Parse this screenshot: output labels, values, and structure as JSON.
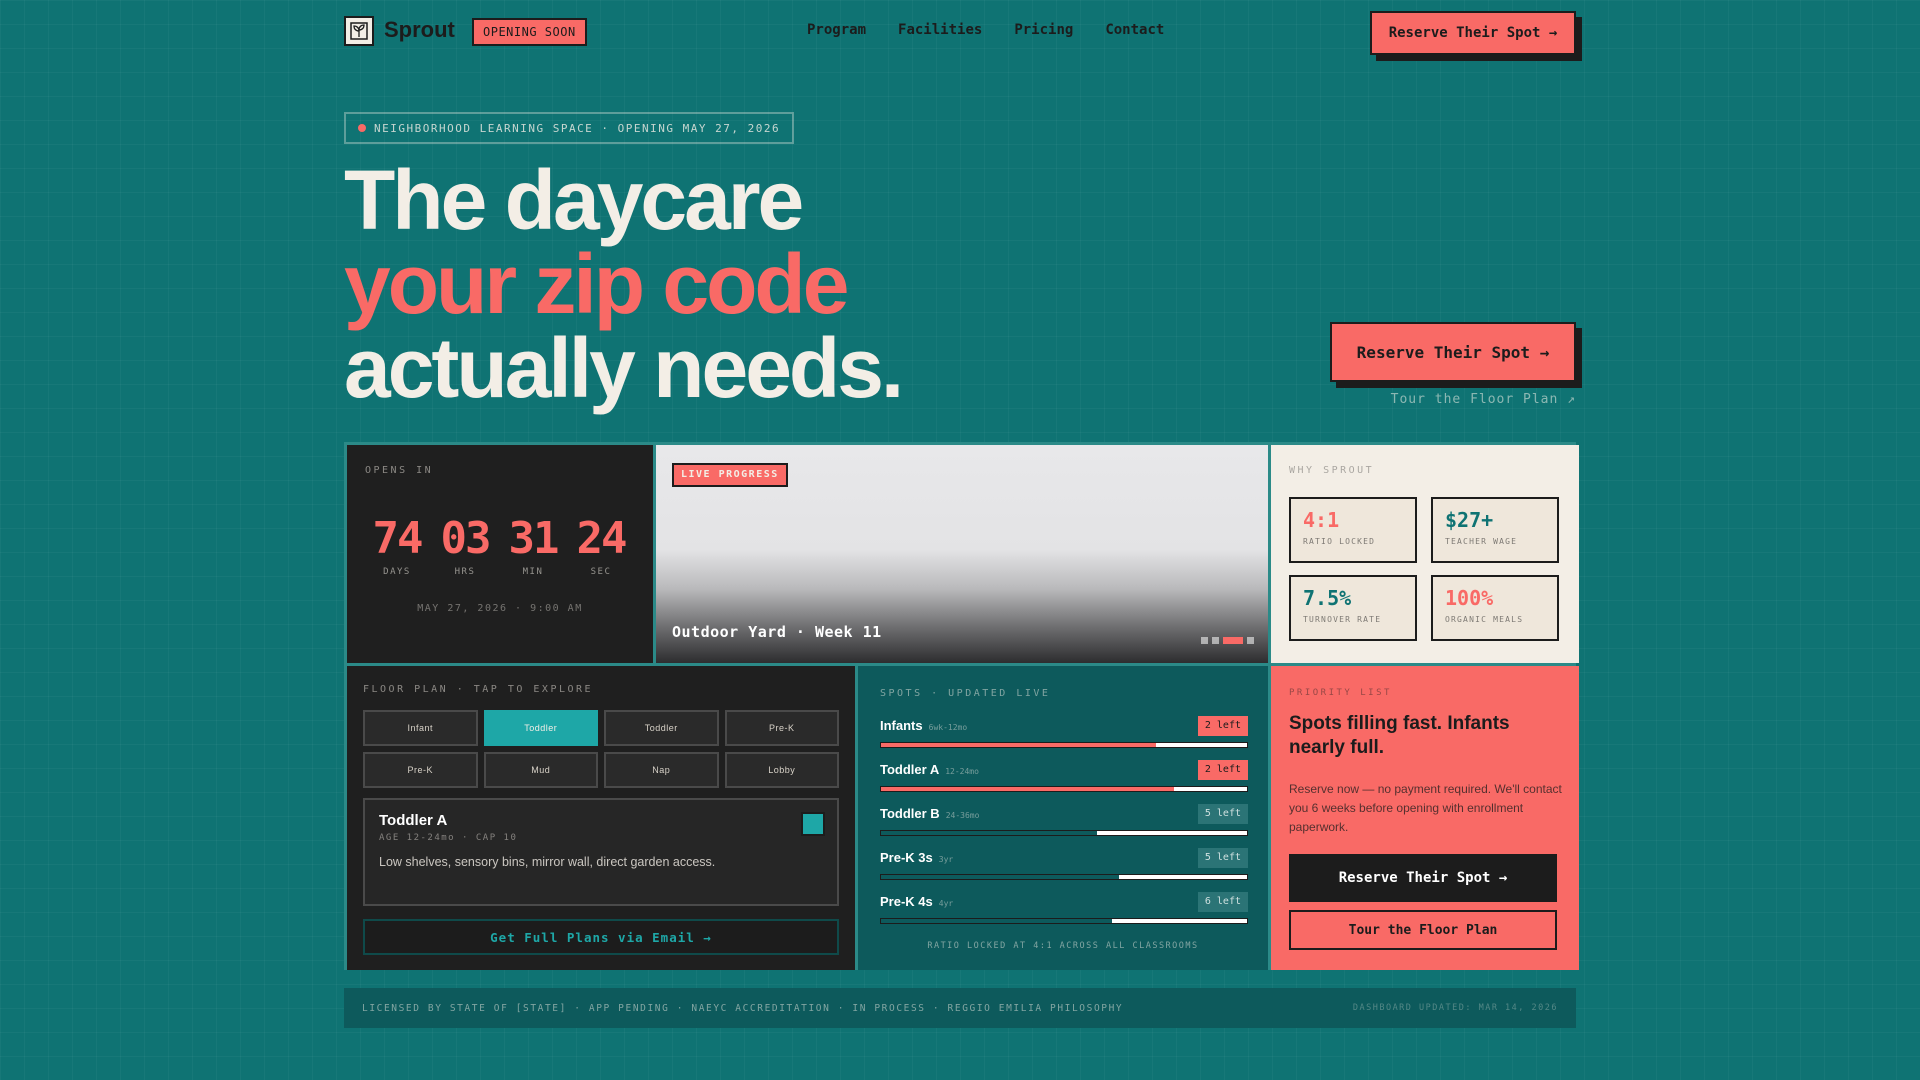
{
  "nav": {
    "brand": "Sprout",
    "logo_icon": "sprout-logo-icon",
    "badge": "OPENING SOON",
    "links": [
      "Program",
      "Facilities",
      "Pricing",
      "Contact"
    ],
    "cta": "Reserve Their Spot →"
  },
  "hero": {
    "eyebrow": "NEIGHBORHOOD LEARNING SPACE · OPENING MAY 27, 2026",
    "line1": "The daycare",
    "line2": "your zip code",
    "line3": "actually needs.",
    "cta": "Reserve Their Spot →",
    "tour_link": "Tour the Floor Plan ↗"
  },
  "countdown": {
    "label": "OPENS IN",
    "units": [
      {
        "value": "74",
        "label": "DAYS"
      },
      {
        "value": "03",
        "label": "HRS"
      },
      {
        "value": "31",
        "label": "MIN"
      },
      {
        "value": "24",
        "label": "SEC"
      }
    ],
    "date": "MAY 27, 2026 · 9:00 AM"
  },
  "photo": {
    "badge": "LIVE PROGRESS",
    "caption": "Outdoor Yard · Week 11",
    "slides": 4,
    "active_slide": 3
  },
  "why": {
    "label": "WHY SPROUT",
    "stats": [
      {
        "value": "4:1",
        "label": "RATIO LOCKED",
        "color": "#f96a66"
      },
      {
        "value": "$27+",
        "label": "TEACHER WAGE",
        "color": "#0f7373"
      },
      {
        "value": "7.5%",
        "label": "TURNOVER RATE",
        "color": "#0f7373"
      },
      {
        "value": "100%",
        "label": "ORGANIC MEALS",
        "color": "#f96a66"
      }
    ]
  },
  "floor": {
    "label": "FLOOR PLAN · TAP TO EXPLORE",
    "rooms": [
      "Infant",
      "Toddler",
      "Toddler",
      "Pre-K",
      "Pre-K",
      "Mud",
      "Nap",
      "Lobby"
    ],
    "active_room": 1,
    "selected": {
      "title": "Toddler A",
      "meta": "AGE 12-24mo · CAP 10",
      "desc": "Low shelves, sensory bins, mirror wall, direct garden access."
    },
    "email_btn": "Get Full Plans via Email →"
  },
  "spots": {
    "label": "SPOTS · UPDATED LIVE",
    "rows": [
      {
        "name": "Infants",
        "age": "6wk-12mo",
        "badge": "2 left",
        "hot": true,
        "filled": 0.75
      },
      {
        "name": "Toddler A",
        "age": "12-24mo",
        "badge": "2 left",
        "hot": true,
        "filled": 0.8
      },
      {
        "name": "Toddler B",
        "age": "24-36mo",
        "badge": "5 left",
        "hot": false,
        "filled": 0.59
      },
      {
        "name": "Pre-K 3s",
        "age": "3yr",
        "badge": "5 left",
        "hot": false,
        "filled": 0.65
      },
      {
        "name": "Pre-K 4s",
        "age": "4yr",
        "badge": "6 left",
        "hot": false,
        "filled": 0.63
      }
    ],
    "footer": "RATIO LOCKED AT 4:1 ACROSS ALL CLASSROOMS"
  },
  "priority": {
    "label": "PRIORITY LIST",
    "heading": "Spots filling fast. Infants nearly full.",
    "body": "Reserve now — no payment required. We'll contact you 6 weeks before opening with enrollment paperwork.",
    "cta": "Reserve Their Spot →",
    "secondary": "Tour the Floor Plan"
  },
  "footer": {
    "left": "LICENSED BY STATE OF [STATE] · APP PENDING · NAEYC ACCREDITATION · IN PROCESS · REGGIO EMILIA PHILOSOPHY",
    "right": "DASHBOARD UPDATED: MAR 14, 2026"
  },
  "colors": {
    "bg": "#0f7373",
    "coral": "#f96a66",
    "ink": "#1c1c1c",
    "cream": "#f3eee6",
    "teal_bright": "#1ea7a7"
  }
}
